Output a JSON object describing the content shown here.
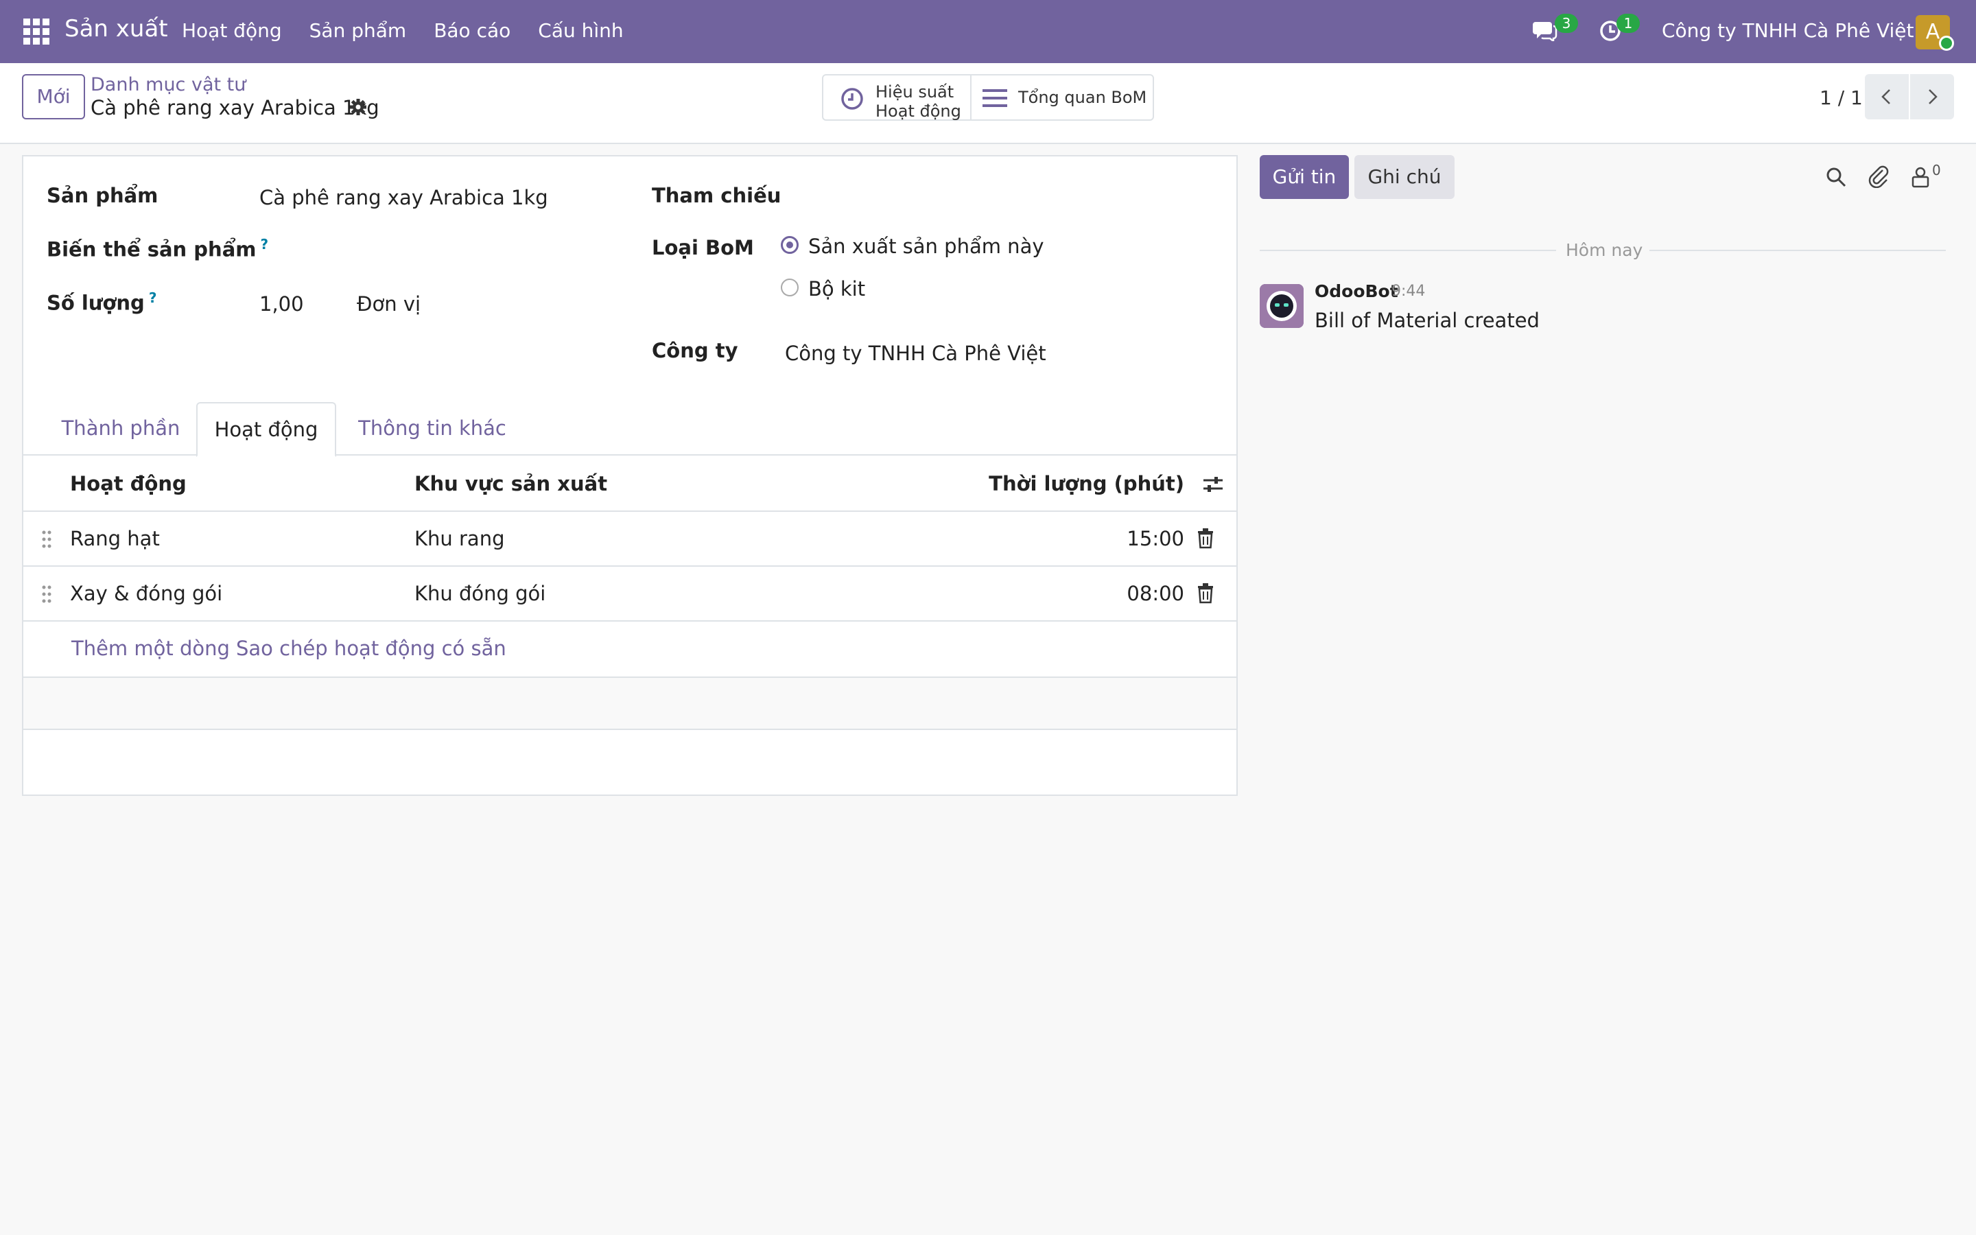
{
  "navbar": {
    "app_name": "Sản xuất",
    "menu": [
      "Hoạt động",
      "Sản phẩm",
      "Báo cáo",
      "Cấu hình"
    ],
    "chat_count": "3",
    "activity_count": "1",
    "company": "Công ty TNHH Cà Phê Việt",
    "avatar_letter": "A"
  },
  "control": {
    "new_label": "Mới",
    "breadcrumb_parent": "Danh mục vật tư",
    "breadcrumb_current": "Cà phê rang xay Arabica 1kg",
    "smart_btn1_line1": "Hiệu suất",
    "smart_btn1_line2": "Hoạt động",
    "smart_btn2_label": "Tổng quan BoM",
    "pager": "1 / 1"
  },
  "form": {
    "product_label": "Sản phẩm",
    "product_value": "Cà phê rang xay Arabica 1kg",
    "variant_label": "Biến thể sản phẩm",
    "qty_label": "Số lượng",
    "qty_value": "1,00",
    "uom_value": "Đơn vị",
    "help_mark": "?",
    "ref_label": "Tham chiếu",
    "bom_type_label": "Loại BoM",
    "bom_type_options": [
      "Sản xuất sản phẩm này",
      "Bộ kit"
    ],
    "company_label": "Công ty",
    "company_value": "Công ty TNHH Cà Phê Việt"
  },
  "tabs": [
    "Thành phần",
    "Hoạt động",
    "Thông tin khác"
  ],
  "table": {
    "headers": [
      "Hoạt động",
      "Khu vực sản xuất",
      "Thời lượng (phút)"
    ],
    "rows": [
      {
        "operation": "Rang hạt",
        "workcenter": "Khu rang",
        "duration": "15:00"
      },
      {
        "operation": "Xay & đóng gói",
        "workcenter": "Khu đóng gói",
        "duration": "08:00"
      }
    ],
    "add_line": "Thêm một dòng",
    "copy_ops": "Sao chép hoạt động có sẵn"
  },
  "chatter": {
    "send_label": "Gửi tin",
    "note_label": "Ghi chú",
    "follower_count": "0",
    "date_label": "Hôm nay",
    "author": "OdooBot",
    "time": "9:44",
    "message": "Bill of Material created"
  },
  "colors": {
    "brand": "#71639e",
    "badge": "#28a745",
    "link": "#71639e"
  }
}
